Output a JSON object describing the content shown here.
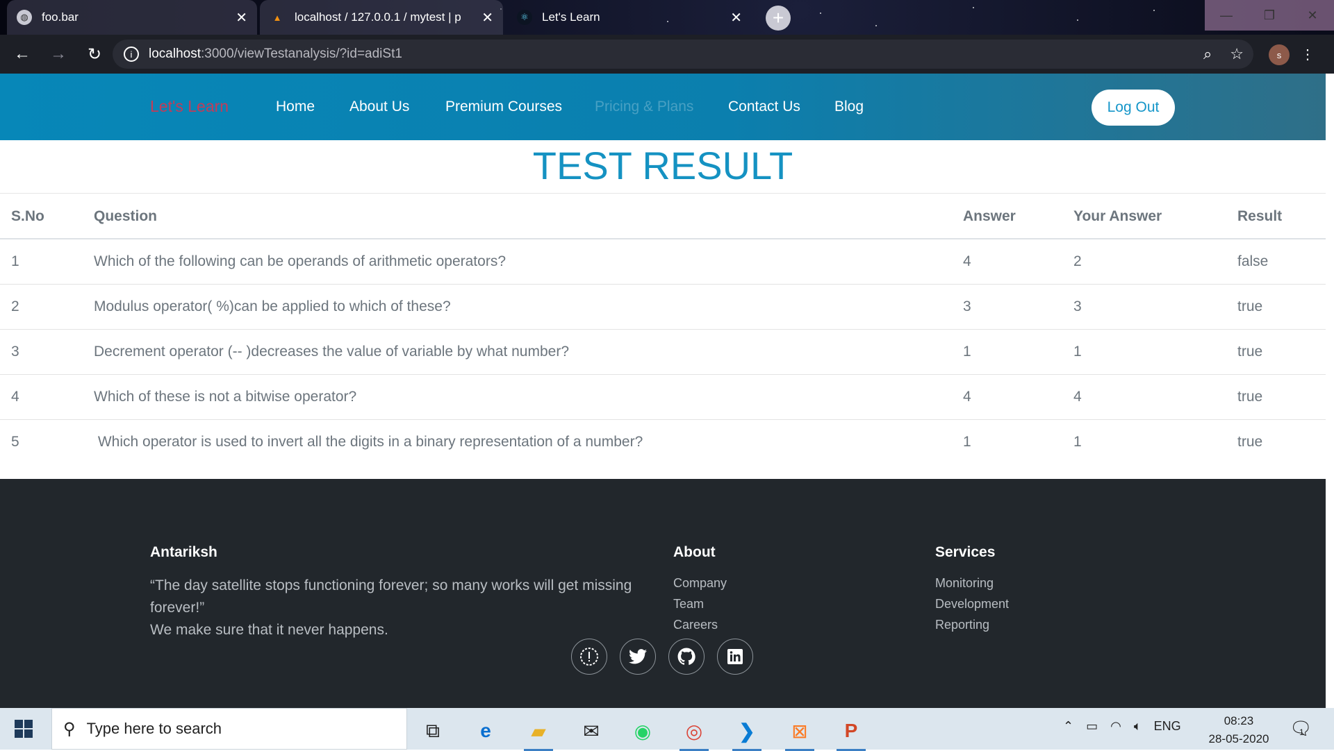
{
  "browser": {
    "tabs": [
      {
        "title": "foo.bar",
        "favicon": "globe-icon",
        "state": "inactive"
      },
      {
        "title": "localhost / 127.0.0.1 / mytest | p",
        "favicon": "phpmyadmin-icon",
        "state": "inactive"
      },
      {
        "title": "Let's Learn",
        "favicon": "react-icon",
        "state": "active"
      }
    ],
    "url_host": "localhost",
    "url_rest": ":3000/viewTestanalysis/?id=adiSt1",
    "avatar_letter": "s"
  },
  "site": {
    "brand": "Let's Learn",
    "nav": [
      {
        "label": "Home",
        "enabled": true
      },
      {
        "label": "About Us",
        "enabled": true
      },
      {
        "label": "Premium Courses",
        "enabled": true
      },
      {
        "label": "Pricing & Plans",
        "enabled": false
      },
      {
        "label": "Contact Us",
        "enabled": true
      },
      {
        "label": "Blog",
        "enabled": true
      }
    ],
    "logout_label": "Log Out"
  },
  "page_title": "TEST RESULT",
  "table": {
    "headers": [
      "S.No",
      "Question",
      "Answer",
      "Your Answer",
      "Result"
    ],
    "rows": [
      [
        "1",
        "Which of the following can be operands of arithmetic operators?",
        "4",
        "2",
        "false"
      ],
      [
        "2",
        "Modulus operator( %)can be applied to which of these?",
        "3",
        "3",
        "true"
      ],
      [
        "3",
        "Decrement operator (-- )decreases the value of variable by what number?",
        "1",
        "1",
        "true"
      ],
      [
        "4",
        "Which of these is not a bitwise operator?",
        "4",
        "4",
        "true"
      ],
      [
        "5",
        " Which operator is used to invert all the digits in a binary representation of a number?",
        "1",
        "1",
        "true"
      ]
    ]
  },
  "footer": {
    "col1": {
      "heading": "Antariksh",
      "quote_line1": "“The day satellite stops functioning forever; so many works will get missing",
      "quote_line2": "forever!”",
      "tagline": "We make sure that it never happens."
    },
    "col2": {
      "heading": "About",
      "links": [
        "Company",
        "Team",
        "Careers"
      ]
    },
    "col3": {
      "heading": "Services",
      "links": [
        "Monitoring",
        "Development",
        "Reporting"
      ]
    },
    "social": [
      "alert-icon",
      "twitter-icon",
      "github-icon",
      "linkedin-icon"
    ]
  },
  "taskbar": {
    "search_placeholder": "Type here to search",
    "apps": [
      "task-view-icon",
      "edge-icon",
      "file-explorer-icon",
      "mail-icon",
      "whatsapp-icon",
      "chrome-icon",
      "vscode-icon",
      "xampp-icon",
      "powerpoint-icon"
    ],
    "language": "ENG",
    "time": "08:23",
    "date": "28-05-2020",
    "notification_count": "1"
  },
  "colors": {
    "nav_bg": "#0787b8",
    "brand": "#c23c59",
    "title": "#1592c2",
    "footer_bg": "#22272c"
  }
}
